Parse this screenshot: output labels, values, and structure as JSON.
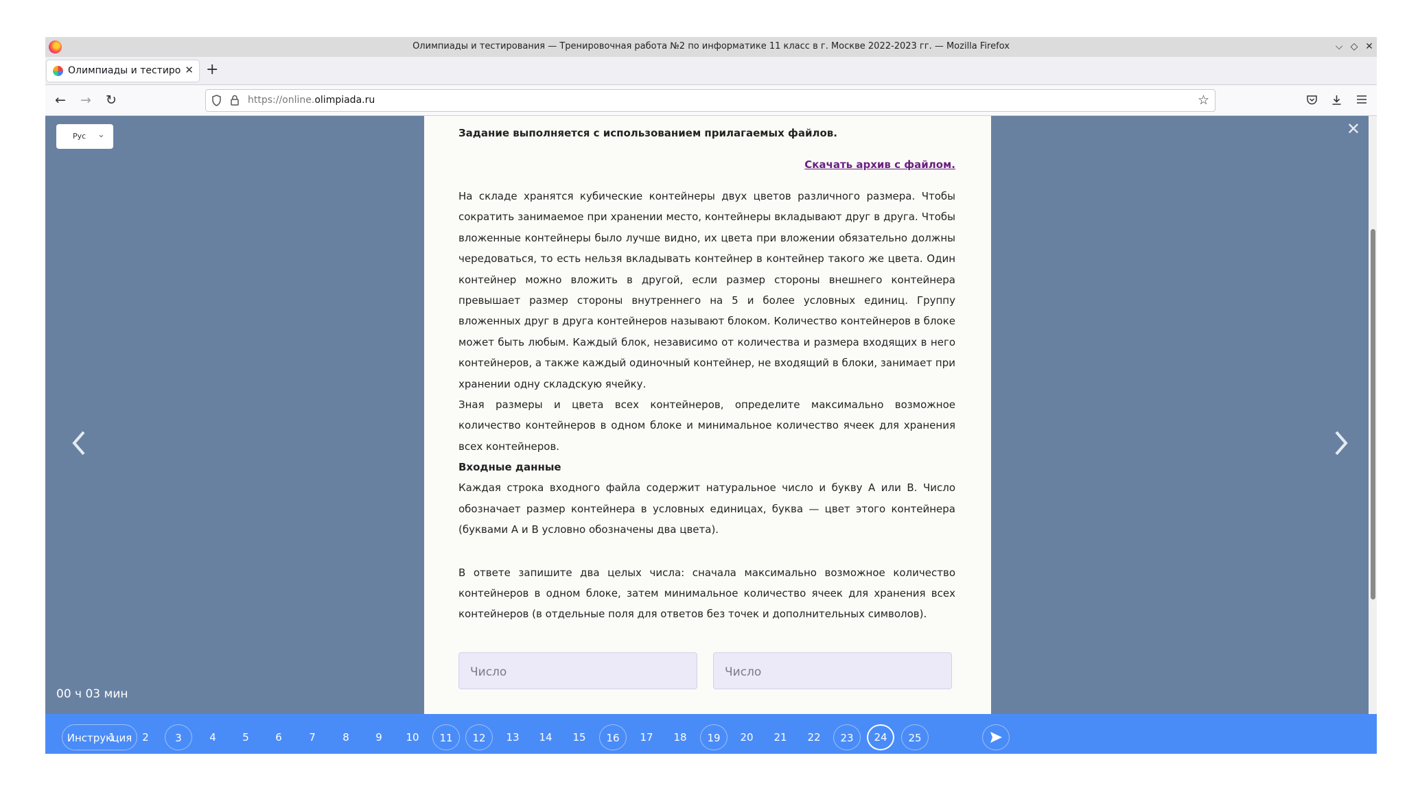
{
  "window": {
    "title": "Олимпиады и тестирования — Тренировочная работа №2 по информатике 11 класс в г. Москве 2022-2023 гг. — Mozilla Firefox",
    "controls": [
      "⌵",
      "◇",
      "✕"
    ]
  },
  "tabs": [
    {
      "title": "Олимпиады и тестирования",
      "close": "✕"
    }
  ],
  "newtab": "+",
  "nav": {
    "back": "←",
    "forward": "→",
    "reload": "↻",
    "url_prefix": "https://online.",
    "url_domain": "olimpiada.ru",
    "star": "☆"
  },
  "toolbar_icons": [
    "pocket-icon",
    "download-icon",
    "menu-icon"
  ],
  "page": {
    "language": "Рус",
    "close": "✕",
    "prev_arrow": "‹",
    "next_arrow": "›",
    "timer": "00 ч 03 мин",
    "task": {
      "intro": "Задание выполняется с использованием прилагаемых файлов.",
      "download_link": "Скачать архив с файлом.",
      "paragraph1": "На складе хранятся кубические контейнеры двух цветов различного размера. Чтобы сократить занимаемое при хранении место, контейнеры вкладывают друг в друга. Чтобы вложенные контейнеры было лучше видно, их цвета при вложении обязательно должны чередоваться, то есть нельзя вкладывать контейнер в контейнер такого же цвета. Один контейнер можно вложить в другой, если размер стороны внешнего контейнера превышает размер стороны внутреннего на 5 и более условных единиц. Группу вложенных друг в друга контейнеров называют блоком. Количество контейнеров в блоке может быть любым. Каждый блок, независимо от количества и размера входящих в него контейнеров, а также каждый одиночный контейнер, не входящий в блоки, занимает при хранении одну складскую ячейку.",
      "paragraph2": "Зная размеры и цвета всех контейнеров, определите максимально возможное количество контейнеров в одном блоке и минимальное количество ячеек для хранения всех контейнеров.",
      "input_heading": "Входные данные",
      "paragraph3": "Каждая строка входного файла содержит натуральное число и букву A или B. Число обозначает размер контейнера в условных единицах, буква — цвет этого контейнера (буквами A и B условно обозначены два цвета).",
      "paragraph4": "В ответе запишите два целых числа: сначала максимально возможное количество контейнеров в одном блоке, затем минимальное количество ячеек для хранения всех контейнеров (в отдельные поля для ответов без точек и дополнительных символов).",
      "answer1_placeholder": "Число",
      "answer2_placeholder": "Число"
    }
  },
  "footer": {
    "instructions": "Инструкция",
    "numbers": [
      "1",
      "2",
      "3",
      "4",
      "5",
      "6",
      "7",
      "8",
      "9",
      "10",
      "11",
      "12",
      "13",
      "14",
      "15",
      "16",
      "17",
      "18",
      "19",
      "20",
      "21",
      "22",
      "23",
      "24",
      "25"
    ],
    "circled": [
      "3",
      "11",
      "12",
      "16",
      "19",
      "23",
      "25"
    ],
    "active": "24"
  },
  "colors": {
    "background": "#6981a1",
    "footer": "#4a8cf7",
    "panel": "#fbfbf8",
    "link": "#6a1f7f",
    "input_bg": "#ece9f8"
  }
}
